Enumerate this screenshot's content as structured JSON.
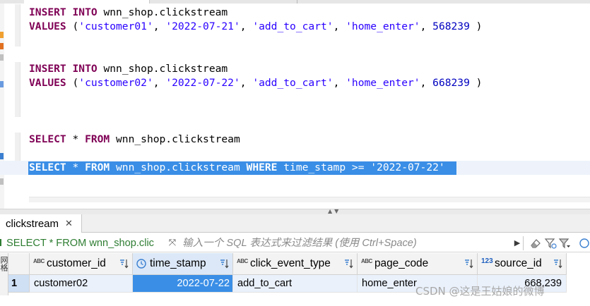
{
  "editor": {
    "lines": [
      {
        "id": "ins1",
        "tokens": [
          {
            "t": "INSERT",
            "c": "kw"
          },
          {
            "t": " ",
            "c": "plain"
          },
          {
            "t": "INTO",
            "c": "kw"
          },
          {
            "t": " wnn_shop.clickstream",
            "c": "plain"
          }
        ]
      },
      {
        "id": "val1",
        "tokens": [
          {
            "t": "VALUES",
            "c": "kw"
          },
          {
            "t": " (",
            "c": "plain"
          },
          {
            "t": "'customer01'",
            "c": "str"
          },
          {
            "t": ", ",
            "c": "plain"
          },
          {
            "t": "'2022-07-21'",
            "c": "str"
          },
          {
            "t": ", ",
            "c": "plain"
          },
          {
            "t": "'add_to_cart'",
            "c": "str"
          },
          {
            "t": ", ",
            "c": "plain"
          },
          {
            "t": "'home_enter'",
            "c": "str"
          },
          {
            "t": ", ",
            "c": "plain"
          },
          {
            "t": "568239",
            "c": "num"
          },
          {
            "t": " )",
            "c": "plain"
          }
        ]
      },
      {
        "id": "ins2",
        "tokens": [
          {
            "t": "INSERT",
            "c": "kw"
          },
          {
            "t": " ",
            "c": "plain"
          },
          {
            "t": "INTO",
            "c": "kw"
          },
          {
            "t": " wnn_shop.clickstream",
            "c": "plain"
          }
        ]
      },
      {
        "id": "val2",
        "tokens": [
          {
            "t": "VALUES",
            "c": "kw"
          },
          {
            "t": " (",
            "c": "plain"
          },
          {
            "t": "'customer02'",
            "c": "str"
          },
          {
            "t": ", ",
            "c": "plain"
          },
          {
            "t": "'2022-07-22'",
            "c": "str"
          },
          {
            "t": ", ",
            "c": "plain"
          },
          {
            "t": "'add_to_cart'",
            "c": "str"
          },
          {
            "t": ", ",
            "c": "plain"
          },
          {
            "t": "'home_enter'",
            "c": "str"
          },
          {
            "t": ", ",
            "c": "plain"
          },
          {
            "t": "668239",
            "c": "num"
          },
          {
            "t": " )",
            "c": "plain"
          }
        ]
      },
      {
        "id": "sel1",
        "tokens": [
          {
            "t": "SELECT",
            "c": "kw"
          },
          {
            "t": " * ",
            "c": "plain"
          },
          {
            "t": "FROM",
            "c": "kw"
          },
          {
            "t": " wnn_shop.clickstream",
            "c": "plain"
          }
        ]
      },
      {
        "id": "sel2",
        "tokens": [
          {
            "t": "SELECT",
            "c": "kw"
          },
          {
            "t": " * ",
            "c": "plain"
          },
          {
            "t": "FROM",
            "c": "kw"
          },
          {
            "t": " wnn_shop.clickstream ",
            "c": "plain"
          },
          {
            "t": "WHERE",
            "c": "kw"
          },
          {
            "t": " time_stamp >= ",
            "c": "plain"
          },
          {
            "t": "'2022-07-22'",
            "c": "str"
          }
        ]
      }
    ]
  },
  "results": {
    "tab_label": "clickstream",
    "tab_close": "✕",
    "query_label": "SELECT * FROM wnn_shop.clic",
    "filter_placeholder": "输入一个 SQL 表达式来过滤结果 (使用 Ctrl+Space)",
    "side_tab": "网格",
    "columns": [
      {
        "name": "customer_id",
        "type_icon": "ABC"
      },
      {
        "name": "time_stamp",
        "type_icon": "clock"
      },
      {
        "name": "click_event_type",
        "type_icon": "ABC"
      },
      {
        "name": "page_code",
        "type_icon": "ABC"
      },
      {
        "name": "source_id",
        "type_icon": "123"
      }
    ],
    "rows": [
      {
        "num": "1",
        "cells": [
          "customer02",
          "2022-07-22",
          "add_to_cart",
          "home_enter",
          "668,239"
        ]
      }
    ]
  },
  "watermark": "CSDN @这是王姑娘的微博",
  "icons": {
    "expand": "expand-arrows-icon",
    "run_filter": "play-triangle-icon",
    "erase": "eraser-icon",
    "filter_settings": "filter-settings-icon",
    "filter_dropdown": "filter-dropdown-icon",
    "sort": "sort-arrows-icon"
  },
  "colors": {
    "keyword": "#7f0055",
    "string": "#2a00ff",
    "number": "#0000c0",
    "selection": "#3a8ee6",
    "query_label": "#2e7d32"
  }
}
